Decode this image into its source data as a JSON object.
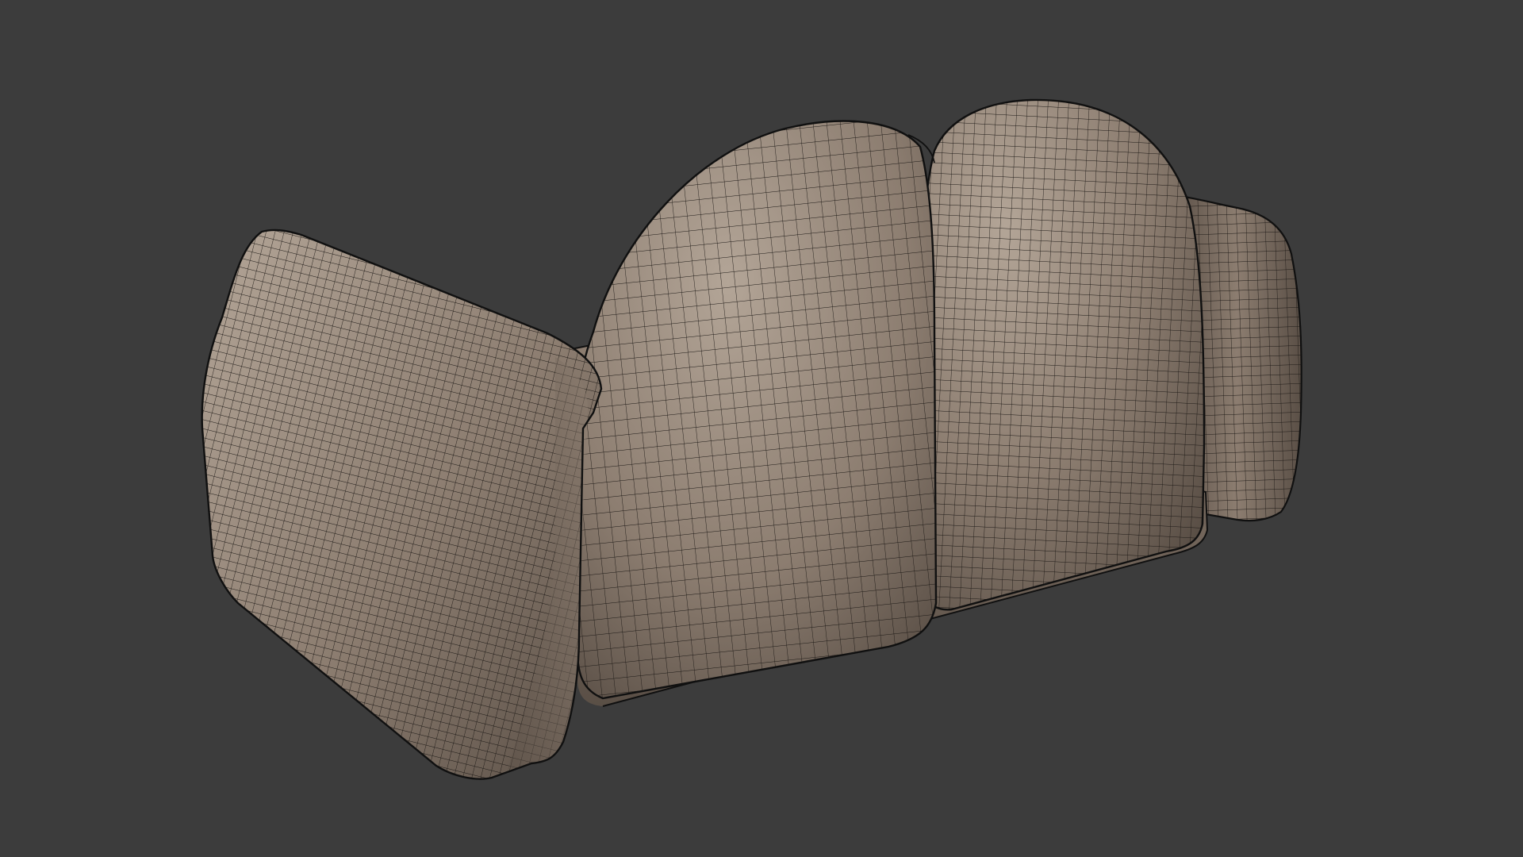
{
  "viewport": {
    "background_color": "#3c3c3c"
  },
  "model": {
    "surface_color": "#8c7d70",
    "highlight_color": "#b3a597",
    "shadow_color": "#5a4f46",
    "wire_color": "#1c1815",
    "outline_color": "#101010"
  }
}
